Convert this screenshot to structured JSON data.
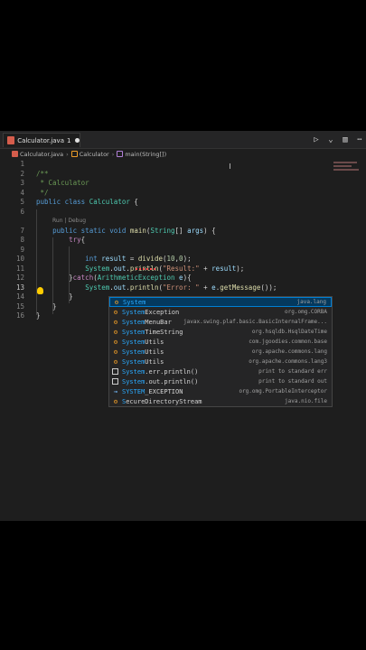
{
  "tab": {
    "label": "Calculator.java",
    "error_count": "1"
  },
  "breadcrumb": [
    "Calculator.java",
    "Calculator",
    "main(String[])"
  ],
  "codelens": "Run | Debug",
  "lines": [
    {
      "n": "1",
      "html": ""
    },
    {
      "n": "2",
      "html": "<span class=\"c-com\">/**</span>"
    },
    {
      "n": "3",
      "html": "<span class=\"c-com\"> * Calculator</span>"
    },
    {
      "n": "4",
      "html": "<span class=\"c-com\"> */</span>"
    },
    {
      "n": "5",
      "html": "<span class=\"c-kw\">public class</span> <span class=\"c-cls\">Calculator</span> <span class=\"c-pun\">{</span>"
    },
    {
      "n": "6",
      "html": ""
    },
    {
      "n": "7",
      "html": "    <span class=\"c-kw\">public static void</span> <span class=\"c-fn\">main</span>(<span class=\"c-cls\">String</span>[] <span class=\"c-var\">args</span>) {"
    },
    {
      "n": "8",
      "html": "        <span class=\"c-kw2\">try</span>{"
    },
    {
      "n": "9",
      "html": ""
    },
    {
      "n": "10",
      "html": "            <span class=\"c-kw\">int</span> <span class=\"c-var\">result</span> = <span class=\"c-fn\">divide</span>(<span class=\"c-num\">10</span>,<span class=\"c-num\">0</span>);"
    },
    {
      "n": "11",
      "html": "            <span class=\"c-cls\">System</span>.<span class=\"c-var\">out</span>.<span class=\"c-fn\">println</span>(<span class=\"c-str\">\"Result:\"</span> + <span class=\"c-var\">result</span>);"
    },
    {
      "n": "12",
      "html": "        }<span class=\"c-kw2\">catch</span>(<span class=\"c-cls\">ArithmeticException</span> <span class=\"c-var\">e</span>){"
    },
    {
      "n": "13",
      "html": "            <span class=\"c-cls\">System</span>.<span class=\"c-var\">out</span>.<span class=\"c-fn\">println</span>(<span class=\"c-str\">\"Error: \"</span> + <span class=\"c-var\">e</span>.<span class=\"c-fn\">getMessage</span>());"
    },
    {
      "n": "14",
      "html": "        }"
    },
    {
      "n": "15",
      "html": "    }"
    },
    {
      "n": "16",
      "html": "}"
    }
  ],
  "suggestions": [
    {
      "icon": "class",
      "label": "System",
      "match": "System",
      "detail": "java.lang",
      "selected": true
    },
    {
      "icon": "class",
      "label": "SystemException",
      "match": "System",
      "detail": "org.omg.CORBA"
    },
    {
      "icon": "class",
      "label": "SystemMenuBar",
      "match": "System",
      "detail": "javax.swing.plaf.basic.BasicInternalFrame..."
    },
    {
      "icon": "class",
      "label": "SystemTimeString",
      "match": "System",
      "detail": "org.hsqldb.HsqlDateTime"
    },
    {
      "icon": "class",
      "label": "SystemUtils",
      "match": "System",
      "detail": "com.jgoodies.common.base"
    },
    {
      "icon": "class",
      "label": "SystemUtils",
      "match": "System",
      "detail": "org.apache.commons.lang"
    },
    {
      "icon": "class",
      "label": "SystemUtils",
      "match": "System",
      "detail": "org.apache.commons.lang3"
    },
    {
      "icon": "snippet",
      "label": "System.err.println()",
      "match": "System",
      "detail": "print to standard err"
    },
    {
      "icon": "snippet",
      "label": "System.out.println()",
      "match": "System",
      "detail": "print to standard out"
    },
    {
      "icon": "field",
      "label": "SYSTEM_EXCEPTION",
      "match": "SYSTEM",
      "detail": "org.omg.PortableInterceptor"
    },
    {
      "icon": "class",
      "label": "SecureDirectoryStream",
      "match": "S",
      "detail": "java.nio.file"
    }
  ]
}
